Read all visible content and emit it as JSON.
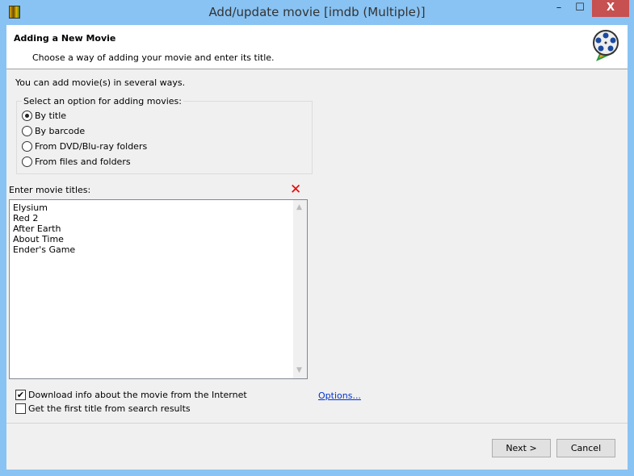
{
  "window": {
    "title": "Add/update movie [imdb (Multiple)]",
    "minimize": "–",
    "maximize": "☐",
    "close": "X"
  },
  "header": {
    "title": "Adding a New Movie",
    "subtitle": "Choose a way of adding your movie and enter its title."
  },
  "intro": "You can add movie(s) in several ways.",
  "options": {
    "label": "Select an option for adding movies:",
    "items": [
      {
        "label": "By title",
        "selected": true
      },
      {
        "label": "By barcode",
        "selected": false
      },
      {
        "label": "From DVD/Blu-ray folders",
        "selected": false
      },
      {
        "label": "From files and folders",
        "selected": false
      }
    ]
  },
  "titles": {
    "label": "Enter movie titles:",
    "clear_icon": "✕",
    "value": "Elysium\nRed 2\nAfter Earth\nAbout Time\nEnder's Game"
  },
  "checks": [
    {
      "label": "Download info about the movie from the Internet",
      "checked": true
    },
    {
      "label": "Get the first title from search results",
      "checked": false
    }
  ],
  "options_link": "Options...",
  "buttons": {
    "next": "Next >",
    "cancel": "Cancel"
  }
}
